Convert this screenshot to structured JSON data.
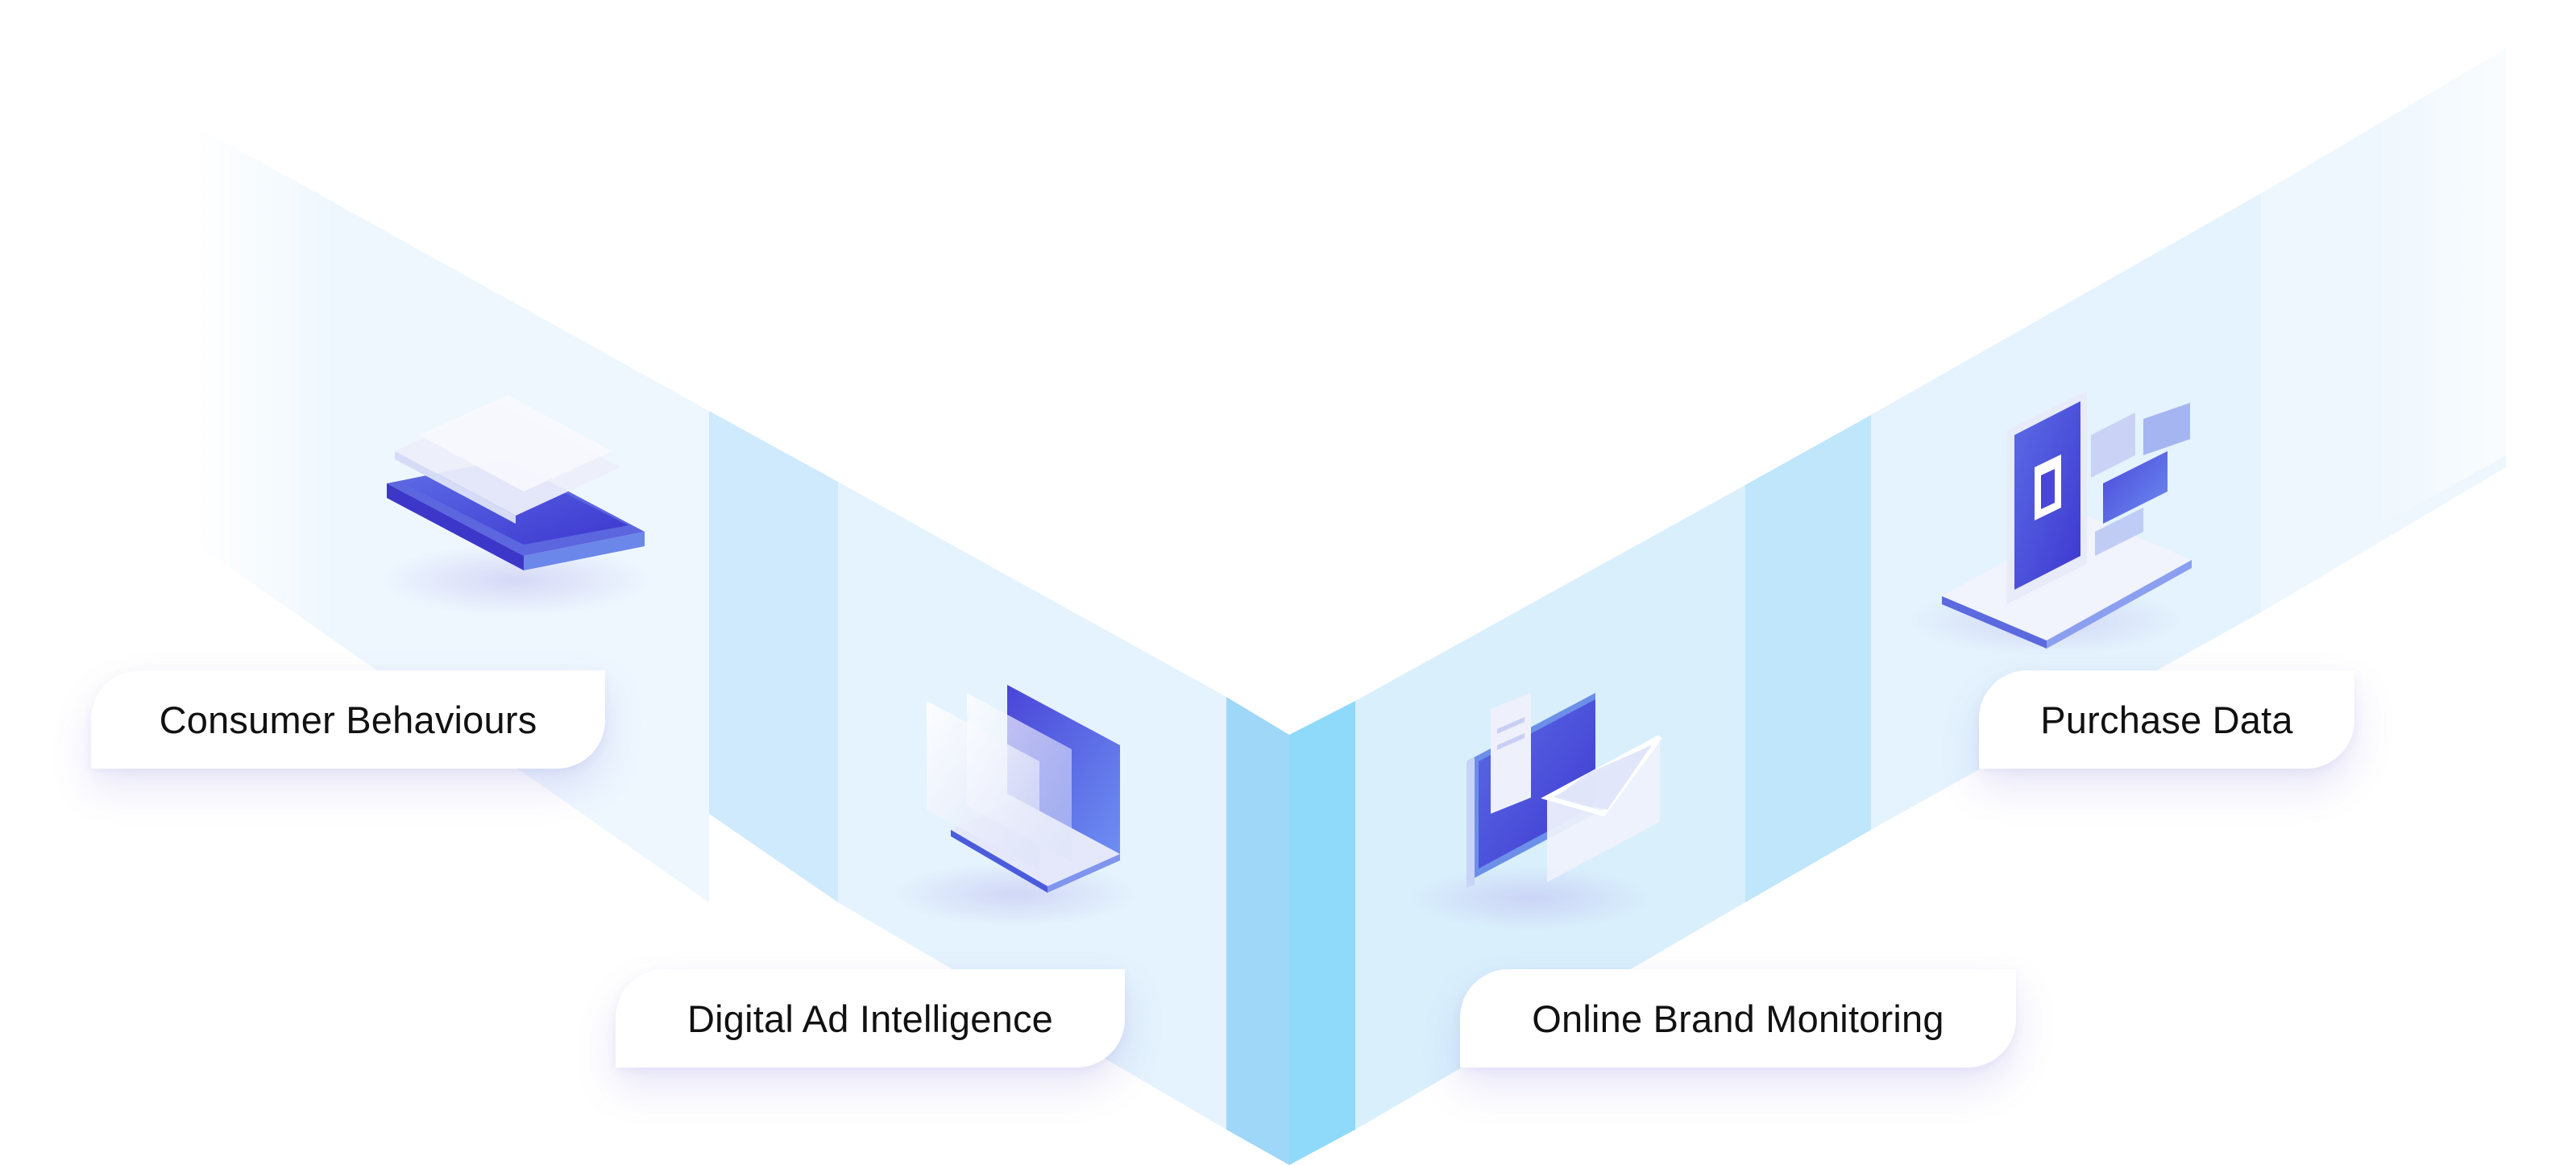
{
  "colors": {
    "band_light": "#eaf5fd",
    "band_medium": "#c6e6fb",
    "band_strong": "#8fd3f8",
    "icon_primary": "#4b46d9",
    "icon_secondary": "#7a8ff0",
    "icon_light": "#e6e9fb",
    "label_text": "#111111",
    "card_background": "#ffffff"
  },
  "categories": [
    {
      "id": "consumer",
      "label": "Consumer Behaviours",
      "icon": "tablet-stack-icon"
    },
    {
      "id": "digital",
      "label": "Digital Ad Intelligence",
      "icon": "laptop-screens-icon"
    },
    {
      "id": "online",
      "label": "Online Brand Monitoring",
      "icon": "monitor-envelope-icon"
    },
    {
      "id": "purchase",
      "label": "Purchase Data",
      "icon": "mobile-dashboard-icon"
    }
  ]
}
